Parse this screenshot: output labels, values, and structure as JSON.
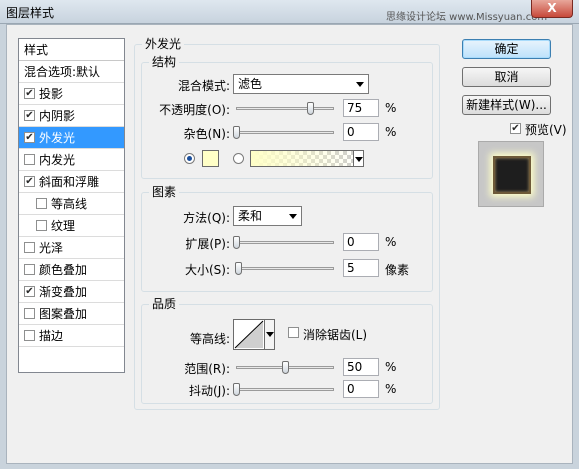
{
  "window": {
    "title": "图层样式",
    "watermark": "思缘设计论坛 www.Missyuan.com",
    "close_glyph": "X"
  },
  "styles_panel": {
    "header": "样式",
    "items": [
      {
        "label": "混合选项:默认",
        "checkbox": false,
        "checked": false,
        "selected": false,
        "sub": false
      },
      {
        "label": "投影",
        "checkbox": true,
        "checked": true,
        "selected": false,
        "sub": false
      },
      {
        "label": "内阴影",
        "checkbox": true,
        "checked": true,
        "selected": false,
        "sub": false
      },
      {
        "label": "外发光",
        "checkbox": true,
        "checked": true,
        "selected": true,
        "sub": false
      },
      {
        "label": "内发光",
        "checkbox": true,
        "checked": false,
        "selected": false,
        "sub": false
      },
      {
        "label": "斜面和浮雕",
        "checkbox": true,
        "checked": true,
        "selected": false,
        "sub": false
      },
      {
        "label": "等高线",
        "checkbox": true,
        "checked": false,
        "selected": false,
        "sub": true
      },
      {
        "label": "纹理",
        "checkbox": true,
        "checked": false,
        "selected": false,
        "sub": true
      },
      {
        "label": "光泽",
        "checkbox": true,
        "checked": false,
        "selected": false,
        "sub": false
      },
      {
        "label": "颜色叠加",
        "checkbox": true,
        "checked": false,
        "selected": false,
        "sub": false
      },
      {
        "label": "渐变叠加",
        "checkbox": true,
        "checked": true,
        "selected": false,
        "sub": false
      },
      {
        "label": "图案叠加",
        "checkbox": true,
        "checked": false,
        "selected": false,
        "sub": false
      },
      {
        "label": "描边",
        "checkbox": true,
        "checked": false,
        "selected": false,
        "sub": false
      }
    ]
  },
  "outer_glow": {
    "title": "外发光",
    "structure": {
      "title": "结构",
      "blend_mode_label": "混合模式:",
      "blend_mode_value": "滤色",
      "opacity_label": "不透明度(O):",
      "opacity_value": "75",
      "opacity_unit": "%",
      "opacity_fraction": 0.75,
      "noise_label": "杂色(N):",
      "noise_value": "0",
      "noise_unit": "%",
      "noise_fraction": 0.0,
      "color_mode": "solid",
      "glow_color": "#ffffc7"
    },
    "elements": {
      "title": "图素",
      "technique_label": "方法(Q):",
      "technique_value": "柔和",
      "spread_label": "扩展(P):",
      "spread_value": "0",
      "spread_unit": "%",
      "spread_fraction": 0.0,
      "size_label": "大小(S):",
      "size_value": "5",
      "size_unit": "像素",
      "size_fraction": 0.02
    },
    "quality": {
      "title": "品质",
      "contour_label": "等高线:",
      "anti_alias_label": "消除锯齿(L)",
      "anti_alias_checked": false,
      "range_label": "范围(R):",
      "range_value": "50",
      "range_unit": "%",
      "range_fraction": 0.5,
      "jitter_label": "抖动(J):",
      "jitter_value": "0",
      "jitter_unit": "%",
      "jitter_fraction": 0.0
    }
  },
  "actions": {
    "ok": "确定",
    "cancel": "取消",
    "new_style": "新建样式(W)...",
    "preview_label": "预览(V)",
    "preview_checked": true
  }
}
